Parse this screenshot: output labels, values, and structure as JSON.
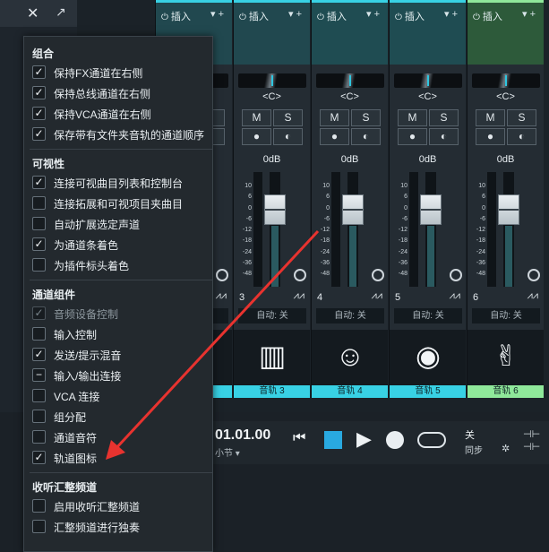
{
  "mixer": {
    "insert_label": "插入",
    "pan_label": "<C>",
    "mute_label": "M",
    "solo_label": "S",
    "db_label": "0dB",
    "scale": [
      "10",
      "6",
      "0",
      "-6",
      "-12",
      "-18",
      "-24",
      "-36",
      "-48"
    ],
    "auto_label": "自动: 关",
    "channels": [
      {
        "num": "3",
        "name": "音轨 3",
        "icon": "mixer-icon",
        "icon_glyph": "▥",
        "color": "#38d1e4",
        "head_color": "#21484f"
      },
      {
        "num": "4",
        "name": "音轨 4",
        "icon": "smile-icon",
        "icon_glyph": "☺",
        "color": "#38d1e4",
        "head_color": "#1f4c52"
      },
      {
        "num": "5",
        "name": "音轨 5",
        "icon": "podcast-icon",
        "icon_glyph": "◉",
        "color": "#38d1e4",
        "head_color": "#1f4c52"
      },
      {
        "num": "6",
        "name": "音轨 6",
        "icon": "rock-hand-icon",
        "icon_glyph": "✌",
        "color": "#8fe89a",
        "head_color": "#2d5a3a"
      }
    ]
  },
  "transport": {
    "time": "01.01.00",
    "time_unit": "小节",
    "sync_state": "关",
    "sync_label": "同步"
  },
  "menu": {
    "sections": [
      {
        "title": "组合",
        "items": [
          {
            "label": "保持FX通道在右侧",
            "state": "✓",
            "enabled": true
          },
          {
            "label": "保持总线通道在右侧",
            "state": "✓",
            "enabled": true
          },
          {
            "label": "保持VCA通道在右侧",
            "state": "✓",
            "enabled": true
          },
          {
            "label": "保存带有文件夹音轨的通道顺序",
            "state": "✓",
            "enabled": true
          }
        ]
      },
      {
        "title": "可视性",
        "items": [
          {
            "label": "连接可视曲目列表和控制台",
            "state": "✓",
            "enabled": true
          },
          {
            "label": "连接拓展和可视项目夹曲目",
            "state": "",
            "enabled": true
          },
          {
            "label": "自动扩展选定声道",
            "state": "",
            "enabled": true
          },
          {
            "label": "为通道条着色",
            "state": "✓",
            "enabled": true
          },
          {
            "label": "为插件标头着色",
            "state": "",
            "enabled": true
          }
        ]
      },
      {
        "title": "通道组件",
        "items": [
          {
            "label": "音频设备控制",
            "state": "✓",
            "enabled": false
          },
          {
            "label": "输入控制",
            "state": "",
            "enabled": true
          },
          {
            "label": "发送/提示混音",
            "state": "✓",
            "enabled": true
          },
          {
            "label": "输入/输出连接",
            "state": "−",
            "enabled": true
          },
          {
            "label": "VCA 连接",
            "state": "",
            "enabled": true
          },
          {
            "label": "组分配",
            "state": "",
            "enabled": true
          },
          {
            "label": "通道音符",
            "state": "",
            "enabled": true
          },
          {
            "label": "轨道图标",
            "state": "✓",
            "enabled": true
          }
        ]
      },
      {
        "title": "收听汇整频道",
        "items": [
          {
            "label": "启用收听汇整频道",
            "state": "",
            "enabled": true
          },
          {
            "label": "汇整频道进行独奏",
            "state": "",
            "enabled": true
          }
        ]
      }
    ]
  }
}
